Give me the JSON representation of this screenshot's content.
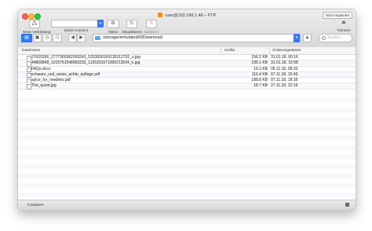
{
  "window": {
    "title": "user@192.168.1.48 – FTP",
    "registration_badge": "Nicht registriert"
  },
  "toolbar": {
    "new_connection_label": "Neue Verbindung",
    "quick_connect_label": "Quick Connect",
    "action_label": "Aktion",
    "refresh_label": "Aktualisieren",
    "edit_label": "Editieren",
    "disconnect_label": "Trennen"
  },
  "navigation": {
    "path": "/storage/emulated/0/Download",
    "search_placeholder": "Suchen"
  },
  "columns": {
    "name": "Dateiname",
    "size": "Größe",
    "date": "Änderungsdatum"
  },
  "files": [
    {
      "name": "27625266_1777360382559243_5253830169135312792_o.jpg",
      "size": "156.2 KB",
      "date": "31.01.18, 00:16"
    },
    {
      "name": "44809848_1015761548993332_1125331571000213504_n.jpg",
      "size": "195.1 KB",
      "date": "31.01.18, 15:58"
    },
    {
      "name": "FAQs.docx",
      "size": "16.3 KB",
      "date": "05.11.18, 09:33"
    },
    {
      "name": "schwarz_und_weiss_achte_auflage.pdf",
      "size": "116.4 KB",
      "date": "07.11.18, 15:43"
    },
    {
      "name": "spice_for_newbies.pdf",
      "size": "188.8 KB",
      "date": "07.11.18, 18:35"
    },
    {
      "name": "The_quest.jpg",
      "size": "18.7 KB",
      "date": "27.11.18, 22:16"
    }
  ],
  "status": {
    "count_text": "6 Dateien"
  }
}
